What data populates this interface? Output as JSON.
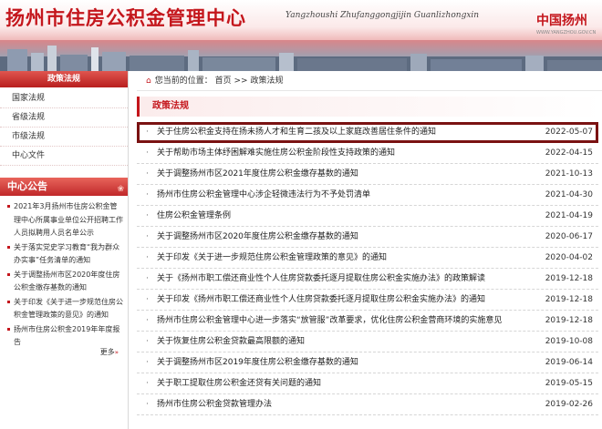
{
  "header": {
    "title": "扬州市住房公积金管理中心",
    "pinyin": "Yangzhoushi Zhufanggongjijin Guanlizhongxin",
    "logo_text": "中国扬州",
    "logo_url": "WWW.YANGZHOU.GOV.CN"
  },
  "sidebar": {
    "heading": "政策法规",
    "items": [
      "国家法规",
      "省级法规",
      "市级法规",
      "中心文件"
    ]
  },
  "notices": {
    "heading": "中心公告",
    "items": [
      "2021年3月扬州市住房公积金管理中心所属事业单位公开招聘工作人员拟聘用人员名单公示",
      "关于落实党史学习教育“我为群众办实事”任务清单的通知",
      "关于调整扬州市区2020年度住房公积金缴存基数的通知",
      "关于印发《关于进一步规范住房公积金管理政策的意见》的通知",
      "扬州市住房公积金2019年年度报告"
    ],
    "more": "更多"
  },
  "breadcrumb": {
    "prefix": "您当前的位置：",
    "home": "首页",
    "sep": ">>",
    "current": "政策法规"
  },
  "section_title": "政策法规",
  "articles": [
    {
      "title": "关于住房公积金支持在扬未扬人才和生育二孩及以上家庭改善居住条件的通知",
      "date": "2022-05-07"
    },
    {
      "title": "关于帮助市场主体纾困解难实施住房公积金阶段性支持政策的通知",
      "date": "2022-04-15"
    },
    {
      "title": "关于调整扬州市区2021年度住房公积金缴存基数的通知",
      "date": "2021-10-13"
    },
    {
      "title": "扬州市住房公积金管理中心涉企轻微违法行为不予处罚清单",
      "date": "2021-04-30"
    },
    {
      "title": "住房公积金管理条例",
      "date": "2021-04-19"
    },
    {
      "title": "关于调整扬州市区2020年度住房公积金缴存基数的通知",
      "date": "2020-06-17"
    },
    {
      "title": "关于印发《关于进一步规范住房公积金管理政策的意见》的通知",
      "date": "2020-04-02"
    },
    {
      "title": "关于《扬州市职工偿还商业性个人住房贷款委托逐月提取住房公积金实施办法》的政策解读",
      "date": "2019-12-18"
    },
    {
      "title": "关于印发《扬州市职工偿还商业性个人住房贷款委托逐月提取住房公积金实施办法》的通知",
      "date": "2019-12-18"
    },
    {
      "title": "扬州市住房公积金管理中心进一步落实“放管服”改革要求，优化住房公积金营商环境的实施意见",
      "date": "2019-12-18"
    },
    {
      "title": "关于恢复住房公积金贷款最高限额的通知",
      "date": "2019-10-08"
    },
    {
      "title": "关于调整扬州市区2019年度住房公积金缴存基数的通知",
      "date": "2019-06-14"
    },
    {
      "title": "关于职工提取住房公积金还贷有关问题的通知",
      "date": "2019-05-15"
    },
    {
      "title": "扬州市住房公积金贷款管理办法",
      "date": "2019-02-26"
    }
  ]
}
